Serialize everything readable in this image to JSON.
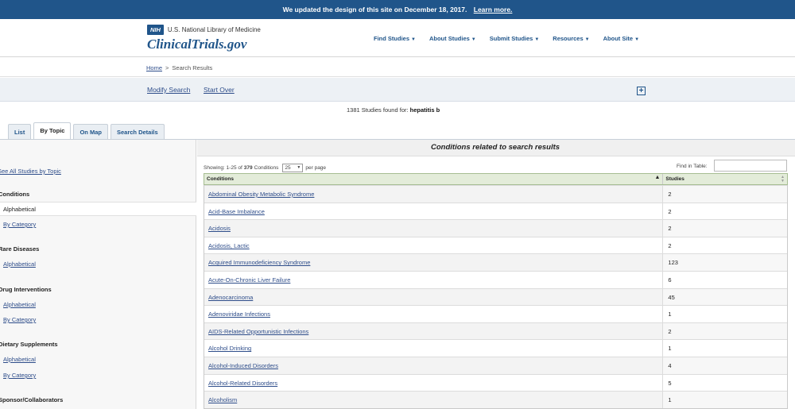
{
  "banner": {
    "text": "We updated the design of this site on December 18, 2017.",
    "link": "Learn more."
  },
  "header": {
    "nih": "NIH",
    "nlm": "U.S. National Library of Medicine",
    "site": "ClinicalTrials.gov",
    "nav": [
      "Find Studies",
      "About Studies",
      "Submit Studies",
      "Resources",
      "About Site"
    ]
  },
  "breadcrumb": {
    "home": "Home",
    "separator": ">",
    "current": "Search Results"
  },
  "actions": {
    "modify": "Modify Search",
    "start_over": "Start Over",
    "expand": "+"
  },
  "results": {
    "count": "1381",
    "found_text": "Studies found for:",
    "query": "hepatitis b"
  },
  "tabs": [
    "List",
    "By Topic",
    "On Map",
    "Search Details"
  ],
  "sidebar": {
    "see_all": "See All Studies by Topic",
    "conditions": "Conditions",
    "alphabetical": "Alphabetical",
    "by_category": "By Category",
    "rare_diseases": "Rare Diseases",
    "drug_interventions": "Drug Interventions",
    "dietary_supplements": "Dietary Supplements",
    "sponsors": "Sponsor/Collaborators"
  },
  "content": {
    "title": "Conditions related to search results",
    "showing_prefix": "Showing: 1-25 of",
    "showing_total": "379",
    "showing_suffix": "Conditions",
    "per_page_value": "25",
    "per_page_label": "per page",
    "find_label": "Find in Table:"
  },
  "table": {
    "headers": [
      "Conditions",
      "Studies"
    ],
    "rows": [
      {
        "condition": "Abdominal Obesity Metabolic Syndrome",
        "studies": "2"
      },
      {
        "condition": "Acid-Base Imbalance",
        "studies": "2"
      },
      {
        "condition": "Acidosis",
        "studies": "2"
      },
      {
        "condition": "Acidosis, Lactic",
        "studies": "2"
      },
      {
        "condition": "Acquired Immunodeficiency Syndrome",
        "studies": "123"
      },
      {
        "condition": "Acute-On-Chronic Liver Failure",
        "studies": "6"
      },
      {
        "condition": "Adenocarcinoma",
        "studies": "45"
      },
      {
        "condition": "Adenoviridae Infections",
        "studies": "1"
      },
      {
        "condition": "AIDS-Related Opportunistic Infections",
        "studies": "2"
      },
      {
        "condition": "Alcohol Drinking",
        "studies": "1"
      },
      {
        "condition": "Alcohol-Induced Disorders",
        "studies": "4"
      },
      {
        "condition": "Alcohol-Related Disorders",
        "studies": "5"
      },
      {
        "condition": "Alcoholism",
        "studies": "1"
      }
    ]
  }
}
